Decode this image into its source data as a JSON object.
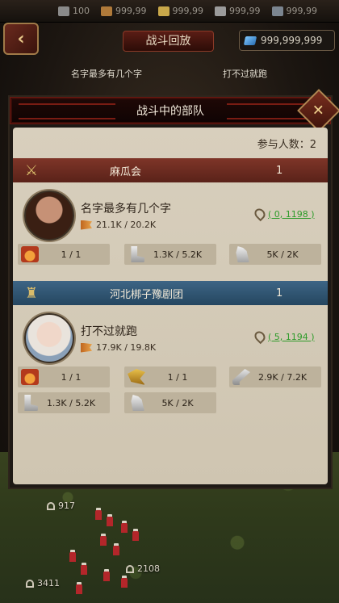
{
  "resources": [
    {
      "icon": "population-icon",
      "value": "100",
      "color": "#8a8a8a"
    },
    {
      "icon": "wood-icon",
      "value": "999,99",
      "color": "#b07a3a"
    },
    {
      "icon": "food-icon",
      "value": "999,99",
      "color": "#c9a84a"
    },
    {
      "icon": "stone-icon",
      "value": "999,99",
      "color": "#9b9b9b"
    },
    {
      "icon": "iron-icon",
      "value": "999,99",
      "color": "#7b8590"
    }
  ],
  "header": {
    "replay_label": "战斗回放",
    "gems": "999,999,999",
    "side_a": "名字最多有几个字",
    "side_b": "打不过就跑"
  },
  "panel": {
    "title": "战斗中的部队",
    "participants_label": "参与人数：",
    "participants_value": "2"
  },
  "alliances": [
    {
      "name": "麻瓜会",
      "count": "1",
      "color": "red",
      "players": [
        {
          "name": "名字最多有几个字",
          "stats": "21.1K / 20.2K",
          "coord": "( 0, 1198 )",
          "avatar": "male",
          "units": [
            {
              "icon": "fire",
              "value": "1 / 1"
            },
            {
              "icon": "boot",
              "value": "1.3K / 5.2K"
            },
            {
              "icon": "horse",
              "value": "5K / 2K"
            }
          ]
        }
      ]
    },
    {
      "name": "河北梆子豫剧团",
      "count": "1",
      "color": "blue",
      "players": [
        {
          "name": "打不过就跑",
          "stats": "17.9K / 19.8K",
          "coord": "( 5, 1194 )",
          "avatar": "female",
          "units": [
            {
              "icon": "fire",
              "value": "1 / 1"
            },
            {
              "icon": "dragon",
              "value": "1 / 1"
            },
            {
              "icon": "siege",
              "value": "2.9K / 7.2K"
            },
            {
              "icon": "boot",
              "value": "1.3K / 5.2K"
            },
            {
              "icon": "horse",
              "value": "5K / 2K"
            }
          ]
        }
      ]
    }
  ],
  "scene": {
    "label_a": "917",
    "label_b": "2108",
    "label_c": "3411"
  },
  "colors": {
    "accent_red": "#7e3528",
    "accent_blue": "#3d6585",
    "coord_green": "#2e9b2a",
    "parchment": "#d8cfbd"
  }
}
